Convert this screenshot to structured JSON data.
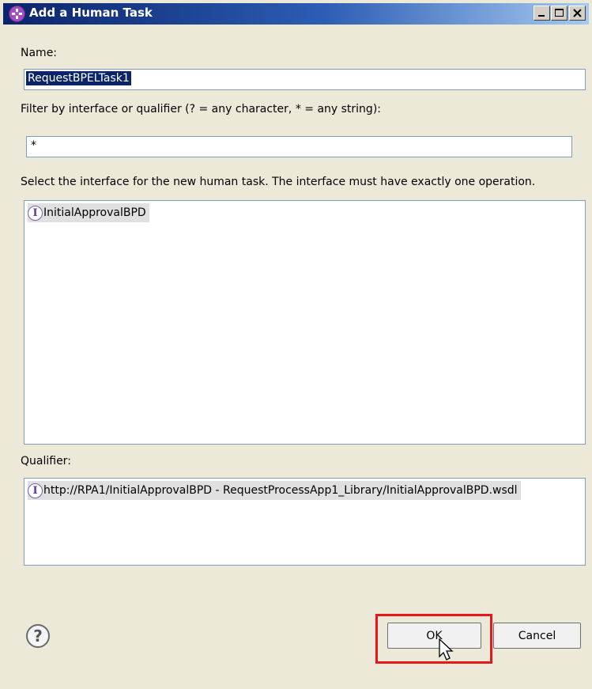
{
  "window": {
    "title": "Add a Human Task",
    "controls": {
      "minimize": "minimize",
      "maximize": "maximize",
      "close": "close"
    }
  },
  "name": {
    "label": "Name:",
    "value": "RequestBPELTask1"
  },
  "filter": {
    "label": "Filter by interface or qualifier (? = any character, * = any string):",
    "value": "*"
  },
  "interfaces": {
    "label": "Select the interface for the new human task. The interface must have exactly one operation.",
    "items": [
      {
        "icon": "interface-icon",
        "label": "InitialApprovalBPD"
      }
    ]
  },
  "qualifier": {
    "label": "Qualifier:",
    "items": [
      {
        "icon": "interface-icon",
        "label": "http://RPA1/InitialApprovalBPD - RequestProcessApp1_Library/InitialApprovalBPD.wsdl"
      }
    ]
  },
  "buttons": {
    "help_icon": "help-icon",
    "ok": "OK",
    "cancel": "Cancel"
  },
  "colors": {
    "title_gradient_start": "#0a246a",
    "selection": "#0a246a",
    "highlight_box": "#e8151b"
  }
}
